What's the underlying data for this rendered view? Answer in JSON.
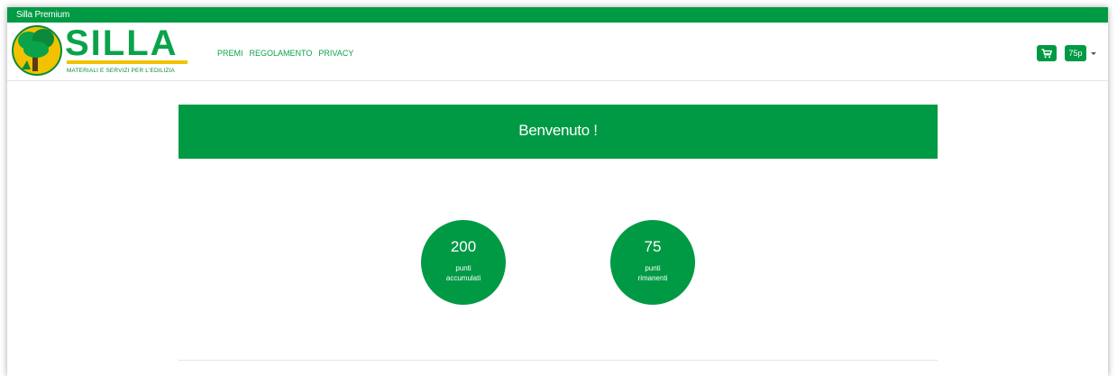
{
  "topbar": {
    "title": "Silla Premium"
  },
  "logo": {
    "name": "SILLA",
    "tagline": "MATERIALI E SERVIZI PER L'EDILIZIA"
  },
  "nav": {
    "items": [
      "PREMI",
      "REGOLAMENTO",
      "PRIVACY"
    ]
  },
  "toolbar": {
    "cart_icon": "shopping-cart-icon",
    "points_label": "75p"
  },
  "banner": {
    "text": "Benvenuto !"
  },
  "stats": [
    {
      "value": "200",
      "label_line1": "punti",
      "label_line2": "accumulati"
    },
    {
      "value": "75",
      "label_line1": "punti",
      "label_line2": "rimanenti"
    }
  ],
  "colors": {
    "brand_green": "#009a44",
    "logo_yellow": "#f2c200"
  }
}
